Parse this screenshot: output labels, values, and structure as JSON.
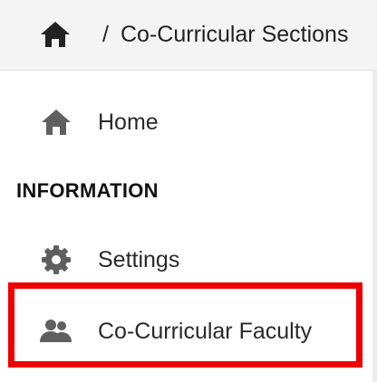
{
  "breadcrumb": {
    "home_icon": "home-icon",
    "separator": "/",
    "current": "Co-Curricular Sections"
  },
  "sidebar": {
    "items": [
      {
        "label": "Home",
        "icon": "home-icon"
      }
    ],
    "sections": [
      {
        "title": "INFORMATION",
        "items": [
          {
            "label": "Settings",
            "icon": "gear-icon"
          },
          {
            "label": "Co-Curricular Faculty",
            "icon": "people-icon",
            "highlighted": true
          }
        ]
      }
    ]
  },
  "colors": {
    "highlight": "#ee0000",
    "icon": "#5f5f5f",
    "topbar_bg": "#f4f4f4"
  }
}
